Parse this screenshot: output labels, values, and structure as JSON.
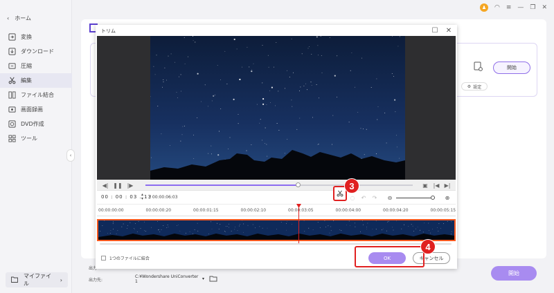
{
  "sidebar": {
    "home": "ホーム",
    "items": [
      {
        "label": "変換",
        "icon": "convert-icon"
      },
      {
        "label": "ダウンロード",
        "icon": "download-icon"
      },
      {
        "label": "圧縮",
        "icon": "compress-icon"
      },
      {
        "label": "編集",
        "icon": "scissors-icon",
        "active": true
      },
      {
        "label": "ファイル結合",
        "icon": "merge-icon"
      },
      {
        "label": "画面録画",
        "icon": "record-icon"
      },
      {
        "label": "DVD作成",
        "icon": "dvd-icon"
      },
      {
        "label": "ツール",
        "icon": "tools-icon"
      }
    ],
    "myfile": "マイファイル"
  },
  "background": {
    "start_small": "開始",
    "settings": "設定",
    "output_label_1": "出力",
    "output_label_2": "出力先:",
    "output_path": "C:¥Wondershare UniConverter 1",
    "main_start": "開始"
  },
  "dialog": {
    "title": "トリム",
    "current_time": "00 : 00 : 03 . 13",
    "total_time": "/ 00:00:06:03",
    "progress": 0.57,
    "ruler_ticks": [
      "00:00:00:00",
      "00:00:00:20",
      "00:00:01:15",
      "00:00:02:10",
      "00:00:03:05",
      "00:00:04:00",
      "00:00:04:20",
      "00:00:05:15"
    ],
    "merge_label": "1つのファイルに結合",
    "ok_label": "OK",
    "cancel_label": "キャンセル"
  },
  "annotations": {
    "step3": "3",
    "step4": "4"
  },
  "colors": {
    "accent": "#a88bf0",
    "highlight": "#e02020",
    "trim_border": "#ff5a1f"
  }
}
